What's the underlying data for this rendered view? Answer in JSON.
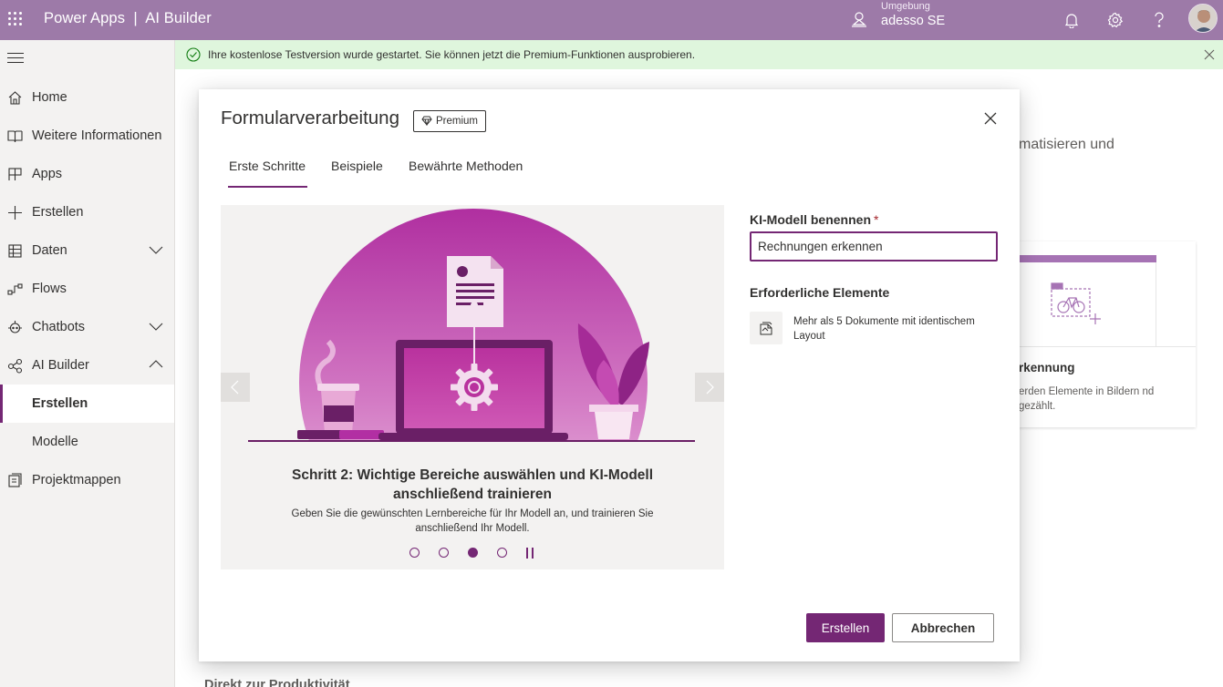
{
  "topbar": {
    "title": "Power Apps  |  AI Builder",
    "environment_label": "Umgebung",
    "environment_name": "adesso SE",
    "icons": [
      "waffle-icon",
      "environment-icon",
      "bell-icon",
      "gear-icon",
      "help-icon",
      "avatar"
    ]
  },
  "notification": {
    "text": "Ihre kostenlose Testversion wurde gestartet. Sie können jetzt die Premium-Funktionen ausprobieren."
  },
  "sidebar": {
    "items": [
      {
        "label": "Home",
        "icon": "home-icon"
      },
      {
        "label": "Weitere Informationen",
        "icon": "book-icon"
      },
      {
        "label": "Apps",
        "icon": "apps-icon"
      },
      {
        "label": "Erstellen",
        "icon": "plus-icon"
      },
      {
        "label": "Daten",
        "icon": "table-icon",
        "expandable": true
      },
      {
        "label": "Flows",
        "icon": "flow-icon"
      },
      {
        "label": "Chatbots",
        "icon": "chatbot-icon",
        "expandable": true
      },
      {
        "label": "AI Builder",
        "icon": "ai-builder-icon",
        "expanded": true
      },
      {
        "label": "Erstellen",
        "active": true
      },
      {
        "label": "Modelle"
      },
      {
        "label": "Projektmappen",
        "icon": "solutions-icon"
      }
    ]
  },
  "background": {
    "partial_text": "matisieren und",
    "card_title": "rkennung",
    "card_desc": "erden Elemente in Bildern nd gezählt.",
    "section_heading": "Direkt zur Produktivität"
  },
  "dialog": {
    "title": "Formularverarbeitung",
    "badge": "Premium",
    "tabs": [
      "Erste Schritte",
      "Beispiele",
      "Bewährte Methoden"
    ],
    "selected_tab": 0,
    "carousel": {
      "step_title": "Schritt 2: Wichtige Bereiche auswählen und KI-Modell anschließend trainieren",
      "step_desc": "Geben Sie die gewünschten Lernbereiche für Ihr Modell an, und trainieren Sie anschließend Ihr Modell.",
      "active_index": 2,
      "count": 4
    },
    "name_field": {
      "label": "KI-Modell benennen",
      "required_mark": "*",
      "value": "Rechnungen erkennen"
    },
    "requirements": {
      "heading": "Erforderliche Elemente",
      "items": [
        "Mehr als 5 Dokumente mit identischem Layout"
      ]
    },
    "buttons": {
      "create": "Erstellen",
      "cancel": "Abbrechen"
    }
  },
  "colors": {
    "brand": "#742774",
    "topbar": "#9d7aa8",
    "notice_bg": "#dff6dd"
  }
}
